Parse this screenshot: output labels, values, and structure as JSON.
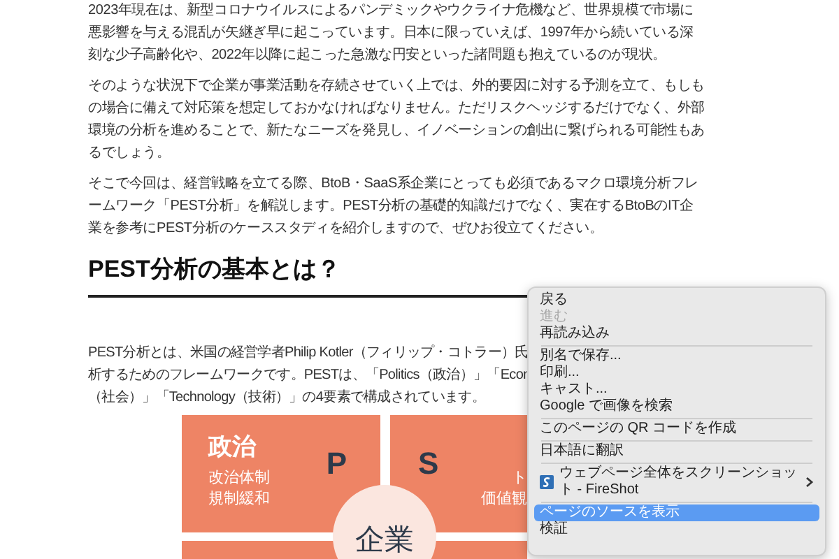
{
  "article": {
    "paragraphs": [
      "2023年現在は、新型コロナウイルスによるパンデミックやウクライナ危機など、世界規模で市場に悪影響を与える混乱が矢継ぎ早に起こっています。日本に限っていえば、1997年から続いている深刻な少子高齢化や、2022年以降に起こった急激な円安といった諸問題も抱えているのが現状。",
      "そのような状況下で企業が事業活動を存続させていく上では、外的要因に対する予測を立て、もしもの場合に備えて対応策を想定しておかなければなりません。ただリスクヘッジするだけでなく、外部環境の分析を進めることで、新たなニーズを発見し、イノベーションの創出に繋げられる可能性もあるでしょう。",
      "そこで今回は、経営戦略を立てる際、BtoB・SaaS系企業にとっても必須であるマクロ環境分析フレームワーク「PEST分析」を解説します。PEST分析の基礎的知識だけでなく、実在するBtoBのIT企業を参考にPEST分析のケーススタディを紹介しますので、ぜひお役立てください。"
    ],
    "heading": "PEST分析の基本とは？",
    "definition_lines": [
      "PEST分析とは、米国の経営学者Philip Kotler（フィリップ・コトラー）氏",
      "析するためのフレームワークです。PESTは、「Politics（政治）」「Econ",
      "（社会）」「Technology（技術）」の4要素で構成されています。"
    ],
    "diagram": {
      "quadrants": [
        {
          "title": "政治",
          "letter": "P",
          "items": [
            "改治体制",
            "規制緩和"
          ]
        },
        {
          "letter": "S",
          "items": [
            "ト",
            "価値観"
          ]
        }
      ],
      "center": "企業"
    }
  },
  "context_menu": [
    {
      "kind": "item",
      "label": "戻る",
      "disabled": false,
      "selected": false
    },
    {
      "kind": "item",
      "label": "進む",
      "disabled": true,
      "selected": false
    },
    {
      "kind": "item",
      "label": "再読み込み",
      "disabled": false,
      "selected": false
    },
    {
      "kind": "separator"
    },
    {
      "kind": "item",
      "label": "別名で保存...",
      "disabled": false,
      "selected": false
    },
    {
      "kind": "item",
      "label": "印刷...",
      "disabled": false,
      "selected": false
    },
    {
      "kind": "item",
      "label": "キャスト...",
      "disabled": false,
      "selected": false
    },
    {
      "kind": "item",
      "label": "Google で画像を検索",
      "disabled": false,
      "selected": false
    },
    {
      "kind": "separator"
    },
    {
      "kind": "item",
      "label": "このページの QR コードを作成",
      "disabled": false,
      "selected": false
    },
    {
      "kind": "separator"
    },
    {
      "kind": "item",
      "label": "日本語に翻訳",
      "disabled": false,
      "selected": false
    },
    {
      "kind": "separator"
    },
    {
      "kind": "submenu",
      "label": "ウェブページ全体をスクリーンショット - FireShot",
      "disabled": false,
      "selected": false
    },
    {
      "kind": "separator"
    },
    {
      "kind": "item",
      "label": "ページのソースを表示",
      "disabled": false,
      "selected": true
    },
    {
      "kind": "item",
      "label": "検証",
      "disabled": false,
      "selected": false
    }
  ]
}
